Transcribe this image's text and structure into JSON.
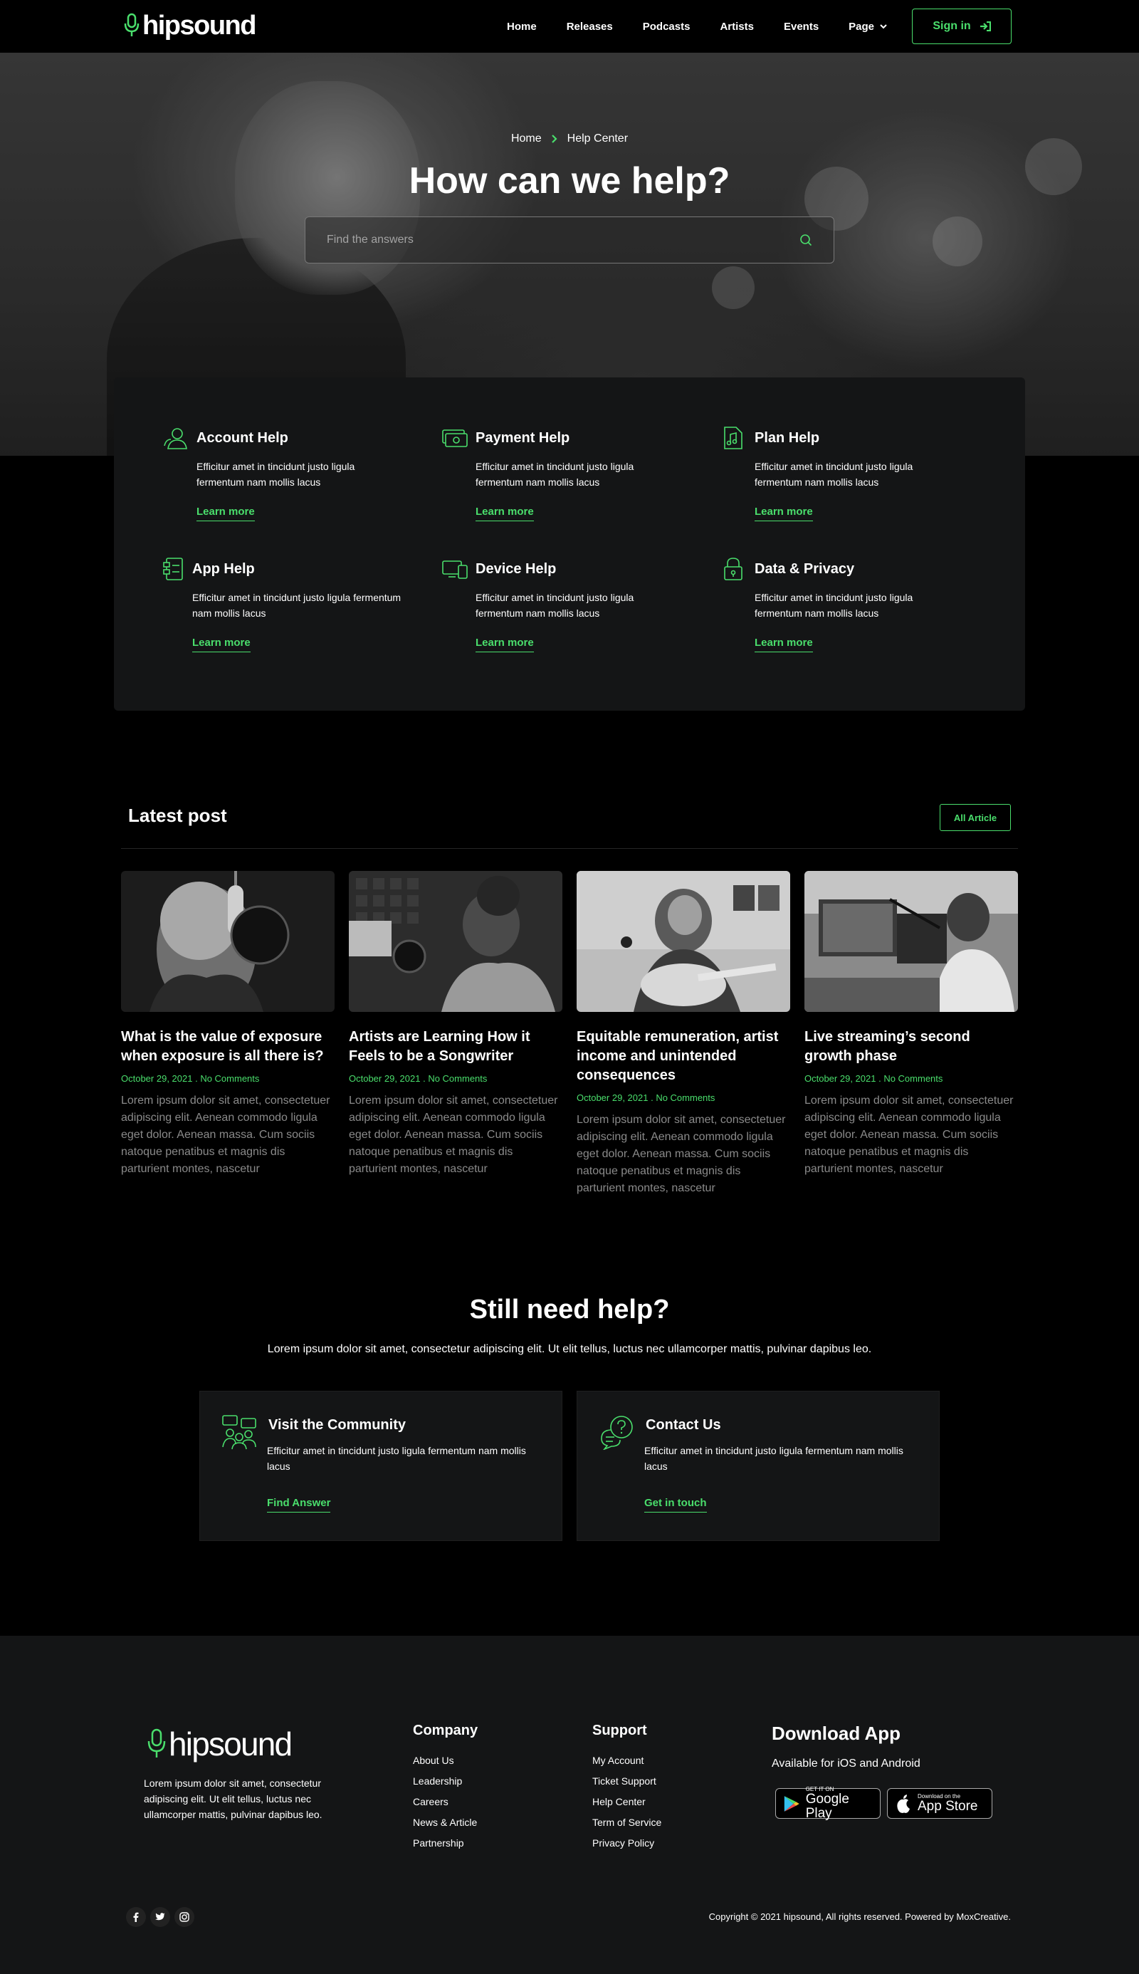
{
  "header": {
    "brand": "hipsound",
    "nav": [
      "Home",
      "Releases",
      "Podcasts",
      "Artists",
      "Events",
      "Page"
    ],
    "signin_label": "Sign in"
  },
  "hero": {
    "breadcrumb": [
      "Home",
      "Help Center"
    ],
    "title": "How can we help?",
    "search_placeholder": "Find the answers"
  },
  "help_topics": [
    {
      "title": "Account Help",
      "desc": "Efficitur amet in tincidunt justo ligula fermentum nam mollis lacus",
      "link": "Learn more",
      "icon": "account-icon"
    },
    {
      "title": "Payment Help",
      "desc": "Efficitur amet in tincidunt justo ligula fermentum nam mollis lacus",
      "link": "Learn more",
      "icon": "payment-icon"
    },
    {
      "title": "Plan Help",
      "desc": "Efficitur amet in tincidunt justo ligula fermentum nam mollis lacus",
      "link": "Learn more",
      "icon": "plan-icon"
    },
    {
      "title": "App Help",
      "desc": "Efficitur amet in tincidunt justo ligula fermentum nam mollis lacus",
      "link": "Learn more",
      "icon": "app-icon"
    },
    {
      "title": "Device Help",
      "desc": "Efficitur amet in tincidunt justo ligula fermentum nam mollis lacus",
      "link": "Learn more",
      "icon": "device-icon"
    },
    {
      "title": "Data & Privacy",
      "desc": "Efficitur amet in tincidunt justo ligula fermentum nam mollis lacus",
      "link": "Learn more",
      "icon": "lock-icon"
    }
  ],
  "latest": {
    "title": "Latest post",
    "all_label": "All Article",
    "posts": [
      {
        "title": "What is the value of exposure when exposure is all there is?",
        "date": "October 29, 2021",
        "comments": "No Comments",
        "excerpt": "Lorem ipsum dolor sit amet, consectetuer adipiscing elit. Aenean commodo ligula eget dolor. Aenean massa. Cum sociis natoque penatibus et magnis dis parturient montes, nascetur"
      },
      {
        "title": "Artists are Learning How it Feels to be a Songwriter",
        "date": "October 29, 2021",
        "comments": "No Comments",
        "excerpt": "Lorem ipsum dolor sit amet, consectetuer adipiscing elit. Aenean commodo ligula eget dolor. Aenean massa. Cum sociis natoque penatibus et magnis dis parturient montes, nascetur"
      },
      {
        "title": "Equitable remuneration, artist income and unintended consequences",
        "date": "October 29, 2021",
        "comments": "No Comments",
        "excerpt": "Lorem ipsum dolor sit amet, consectetuer adipiscing elit. Aenean commodo ligula eget dolor. Aenean massa. Cum sociis natoque penatibus et magnis dis parturient montes, nascetur"
      },
      {
        "title": "Live streaming’s second growth phase",
        "date": "October 29, 2021",
        "comments": "No Comments",
        "excerpt": "Lorem ipsum dolor sit amet, consectetuer adipiscing elit. Aenean commodo ligula eget dolor. Aenean massa. Cum sociis natoque penatibus et magnis dis parturient montes, nascetur"
      }
    ]
  },
  "still_help": {
    "title": "Still need help?",
    "subtitle": "Lorem ipsum dolor sit amet, consectetur adipiscing elit. Ut elit tellus, luctus nec ullamcorper mattis, pulvinar dapibus leo.",
    "cards": [
      {
        "title": "Visit the Community",
        "desc": "Efficitur amet in tincidunt justo ligula fermentum nam mollis lacus",
        "link": "Find Answer",
        "icon": "community-icon"
      },
      {
        "title": "Contact Us",
        "desc": "Efficitur amet in tincidunt justo ligula fermentum nam mollis lacus",
        "link": "Get in touch",
        "icon": "chat-question-icon"
      }
    ]
  },
  "footer": {
    "brand": "hipsound",
    "desc": "Lorem ipsum dolor sit amet, consectetur adipiscing elit. Ut elit tellus, luctus nec ullamcorper mattis, pulvinar dapibus leo.",
    "company_title": "Company",
    "company_links": [
      "About Us",
      "Leadership",
      "Careers",
      "News & Article",
      "Partnership"
    ],
    "support_title": "Support",
    "support_links": [
      "My Account",
      "Ticket Support",
      "Help Center",
      "Term of Service",
      "Privacy Policy"
    ],
    "download_title": "Download App",
    "download_sub": "Available for iOS and Android",
    "google_small": "GET IT ON",
    "google_big": "Google Play",
    "apple_small": "Download on the",
    "apple_big": "App Store",
    "copyright": "Copyright © 2021 hipsound, All rights reserved. Powered by MoxCreative."
  },
  "colors": {
    "accent": "#4ade6c",
    "card": "#141516",
    "background": "#000000"
  }
}
